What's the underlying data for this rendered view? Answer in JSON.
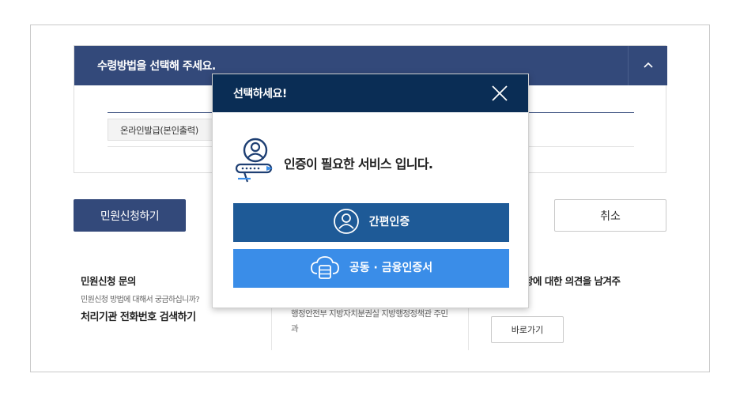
{
  "method_panel": {
    "title": "수령방법을 선택해 주세요.",
    "toggle_icon": "chevron-up-icon",
    "option_label": "온라인발급(본인출력)"
  },
  "actions": {
    "apply_label": "민원신청하기",
    "cancel_label": "취소"
  },
  "info": {
    "inquiry_title": "민원신청 문의",
    "inquiry_desc": "민원신청 방법에 대해서 궁금하십니까?",
    "phone_search": "처리기관 전화번호 검색하기",
    "ministry_text": "행정안전부 지방자치분권실 지방행정정책관 주민과",
    "opinion_text": "선사항에 대한 의견을 남겨주",
    "goto_label": "바로가기"
  },
  "modal": {
    "title": "선택하세요!",
    "close_icon": "close-icon",
    "message": "인증이 필요한 서비스 입니다.",
    "simple_auth_label": "간편인증",
    "cert_label": "공동 · 금융인증서",
    "colors": {
      "header": "#0a2d55",
      "simple_auth": "#1e5a97",
      "cert": "#3a8de8"
    }
  }
}
